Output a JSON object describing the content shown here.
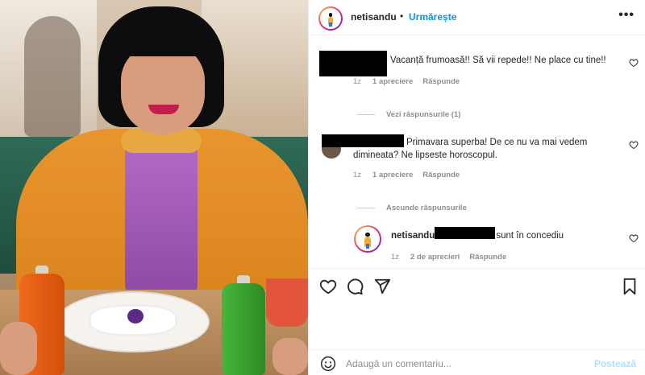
{
  "header": {
    "username": "netisandu",
    "separator": "•",
    "follow_label": "Urmărește",
    "more_icon": "more-horizontal-icon"
  },
  "comments": [
    {
      "text": "Vacanță frumoasă!! Să vii repede!! Ne place cu tine!!",
      "time": "1z",
      "likes": "1 apreciere",
      "reply_label": "Răspunde",
      "replies_toggle": "Vezi răspunsurile (1)"
    },
    {
      "text": "Primavara superba! De ce nu va mai vedem dimineata? Ne lipseste horoscopul.",
      "time": "1z",
      "likes": "1 apreciere",
      "reply_label": "Răspunde",
      "replies_toggle": "Ascunde răspunsurile"
    }
  ],
  "reply": {
    "username": "netisandu",
    "text": "sunt în concediu",
    "time": "1z",
    "likes": "2 de aprecieri",
    "reply_label": "Răspunde"
  },
  "actions": {
    "like_icon": "heart-icon",
    "comment_icon": "comment-icon",
    "share_icon": "send-icon",
    "save_icon": "bookmark-icon"
  },
  "composer": {
    "placeholder": "Adaugă un comentariu...",
    "post_label": "Postează",
    "emoji_icon": "emoji-icon"
  },
  "colors": {
    "accent": "#0095f6",
    "post_disabled": "#b2dffc",
    "meta": "#8e8e8e",
    "text": "#262626"
  }
}
